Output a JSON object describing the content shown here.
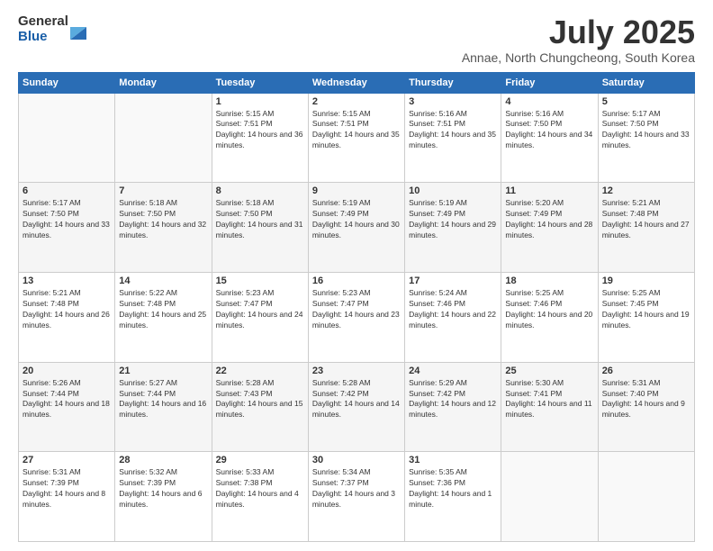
{
  "logo": {
    "general": "General",
    "blue": "Blue"
  },
  "header": {
    "title": "July 2025",
    "subtitle": "Annae, North Chungcheong, South Korea"
  },
  "weekdays": [
    "Sunday",
    "Monday",
    "Tuesday",
    "Wednesday",
    "Thursday",
    "Friday",
    "Saturday"
  ],
  "weeks": [
    [
      {
        "day": "",
        "empty": true
      },
      {
        "day": "",
        "empty": true
      },
      {
        "day": "1",
        "sunrise": "Sunrise: 5:15 AM",
        "sunset": "Sunset: 7:51 PM",
        "daylight": "Daylight: 14 hours and 36 minutes."
      },
      {
        "day": "2",
        "sunrise": "Sunrise: 5:15 AM",
        "sunset": "Sunset: 7:51 PM",
        "daylight": "Daylight: 14 hours and 35 minutes."
      },
      {
        "day": "3",
        "sunrise": "Sunrise: 5:16 AM",
        "sunset": "Sunset: 7:51 PM",
        "daylight": "Daylight: 14 hours and 35 minutes."
      },
      {
        "day": "4",
        "sunrise": "Sunrise: 5:16 AM",
        "sunset": "Sunset: 7:50 PM",
        "daylight": "Daylight: 14 hours and 34 minutes."
      },
      {
        "day": "5",
        "sunrise": "Sunrise: 5:17 AM",
        "sunset": "Sunset: 7:50 PM",
        "daylight": "Daylight: 14 hours and 33 minutes."
      }
    ],
    [
      {
        "day": "6",
        "sunrise": "Sunrise: 5:17 AM",
        "sunset": "Sunset: 7:50 PM",
        "daylight": "Daylight: 14 hours and 33 minutes."
      },
      {
        "day": "7",
        "sunrise": "Sunrise: 5:18 AM",
        "sunset": "Sunset: 7:50 PM",
        "daylight": "Daylight: 14 hours and 32 minutes."
      },
      {
        "day": "8",
        "sunrise": "Sunrise: 5:18 AM",
        "sunset": "Sunset: 7:50 PM",
        "daylight": "Daylight: 14 hours and 31 minutes."
      },
      {
        "day": "9",
        "sunrise": "Sunrise: 5:19 AM",
        "sunset": "Sunset: 7:49 PM",
        "daylight": "Daylight: 14 hours and 30 minutes."
      },
      {
        "day": "10",
        "sunrise": "Sunrise: 5:19 AM",
        "sunset": "Sunset: 7:49 PM",
        "daylight": "Daylight: 14 hours and 29 minutes."
      },
      {
        "day": "11",
        "sunrise": "Sunrise: 5:20 AM",
        "sunset": "Sunset: 7:49 PM",
        "daylight": "Daylight: 14 hours and 28 minutes."
      },
      {
        "day": "12",
        "sunrise": "Sunrise: 5:21 AM",
        "sunset": "Sunset: 7:48 PM",
        "daylight": "Daylight: 14 hours and 27 minutes."
      }
    ],
    [
      {
        "day": "13",
        "sunrise": "Sunrise: 5:21 AM",
        "sunset": "Sunset: 7:48 PM",
        "daylight": "Daylight: 14 hours and 26 minutes."
      },
      {
        "day": "14",
        "sunrise": "Sunrise: 5:22 AM",
        "sunset": "Sunset: 7:48 PM",
        "daylight": "Daylight: 14 hours and 25 minutes."
      },
      {
        "day": "15",
        "sunrise": "Sunrise: 5:23 AM",
        "sunset": "Sunset: 7:47 PM",
        "daylight": "Daylight: 14 hours and 24 minutes."
      },
      {
        "day": "16",
        "sunrise": "Sunrise: 5:23 AM",
        "sunset": "Sunset: 7:47 PM",
        "daylight": "Daylight: 14 hours and 23 minutes."
      },
      {
        "day": "17",
        "sunrise": "Sunrise: 5:24 AM",
        "sunset": "Sunset: 7:46 PM",
        "daylight": "Daylight: 14 hours and 22 minutes."
      },
      {
        "day": "18",
        "sunrise": "Sunrise: 5:25 AM",
        "sunset": "Sunset: 7:46 PM",
        "daylight": "Daylight: 14 hours and 20 minutes."
      },
      {
        "day": "19",
        "sunrise": "Sunrise: 5:25 AM",
        "sunset": "Sunset: 7:45 PM",
        "daylight": "Daylight: 14 hours and 19 minutes."
      }
    ],
    [
      {
        "day": "20",
        "sunrise": "Sunrise: 5:26 AM",
        "sunset": "Sunset: 7:44 PM",
        "daylight": "Daylight: 14 hours and 18 minutes."
      },
      {
        "day": "21",
        "sunrise": "Sunrise: 5:27 AM",
        "sunset": "Sunset: 7:44 PM",
        "daylight": "Daylight: 14 hours and 16 minutes."
      },
      {
        "day": "22",
        "sunrise": "Sunrise: 5:28 AM",
        "sunset": "Sunset: 7:43 PM",
        "daylight": "Daylight: 14 hours and 15 minutes."
      },
      {
        "day": "23",
        "sunrise": "Sunrise: 5:28 AM",
        "sunset": "Sunset: 7:42 PM",
        "daylight": "Daylight: 14 hours and 14 minutes."
      },
      {
        "day": "24",
        "sunrise": "Sunrise: 5:29 AM",
        "sunset": "Sunset: 7:42 PM",
        "daylight": "Daylight: 14 hours and 12 minutes."
      },
      {
        "day": "25",
        "sunrise": "Sunrise: 5:30 AM",
        "sunset": "Sunset: 7:41 PM",
        "daylight": "Daylight: 14 hours and 11 minutes."
      },
      {
        "day": "26",
        "sunrise": "Sunrise: 5:31 AM",
        "sunset": "Sunset: 7:40 PM",
        "daylight": "Daylight: 14 hours and 9 minutes."
      }
    ],
    [
      {
        "day": "27",
        "sunrise": "Sunrise: 5:31 AM",
        "sunset": "Sunset: 7:39 PM",
        "daylight": "Daylight: 14 hours and 8 minutes."
      },
      {
        "day": "28",
        "sunrise": "Sunrise: 5:32 AM",
        "sunset": "Sunset: 7:39 PM",
        "daylight": "Daylight: 14 hours and 6 minutes."
      },
      {
        "day": "29",
        "sunrise": "Sunrise: 5:33 AM",
        "sunset": "Sunset: 7:38 PM",
        "daylight": "Daylight: 14 hours and 4 minutes."
      },
      {
        "day": "30",
        "sunrise": "Sunrise: 5:34 AM",
        "sunset": "Sunset: 7:37 PM",
        "daylight": "Daylight: 14 hours and 3 minutes."
      },
      {
        "day": "31",
        "sunrise": "Sunrise: 5:35 AM",
        "sunset": "Sunset: 7:36 PM",
        "daylight": "Daylight: 14 hours and 1 minute."
      },
      {
        "day": "",
        "empty": true
      },
      {
        "day": "",
        "empty": true
      }
    ]
  ]
}
